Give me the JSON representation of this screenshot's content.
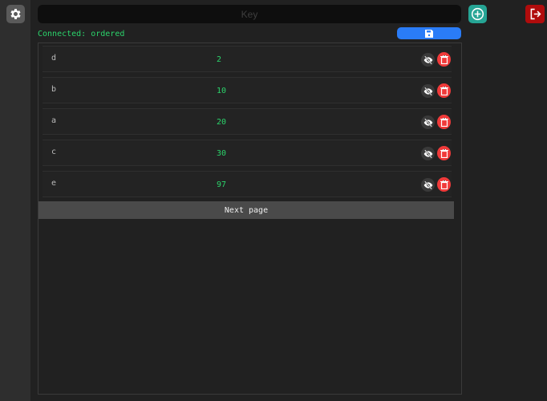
{
  "header": {
    "key_placeholder": "Key",
    "status": "Connected: ordered"
  },
  "colors": {
    "accent": "#2a7cf7",
    "add": "#26a595",
    "logout": "#b00c0c",
    "delete": "#f03a3a",
    "value": "#2bd46b"
  },
  "rows": [
    {
      "key": "d",
      "value": "2"
    },
    {
      "key": "b",
      "value": "10"
    },
    {
      "key": "a",
      "value": "20"
    },
    {
      "key": "c",
      "value": "30"
    },
    {
      "key": "e",
      "value": "97"
    }
  ],
  "pagination": {
    "next_label": "Next page"
  }
}
